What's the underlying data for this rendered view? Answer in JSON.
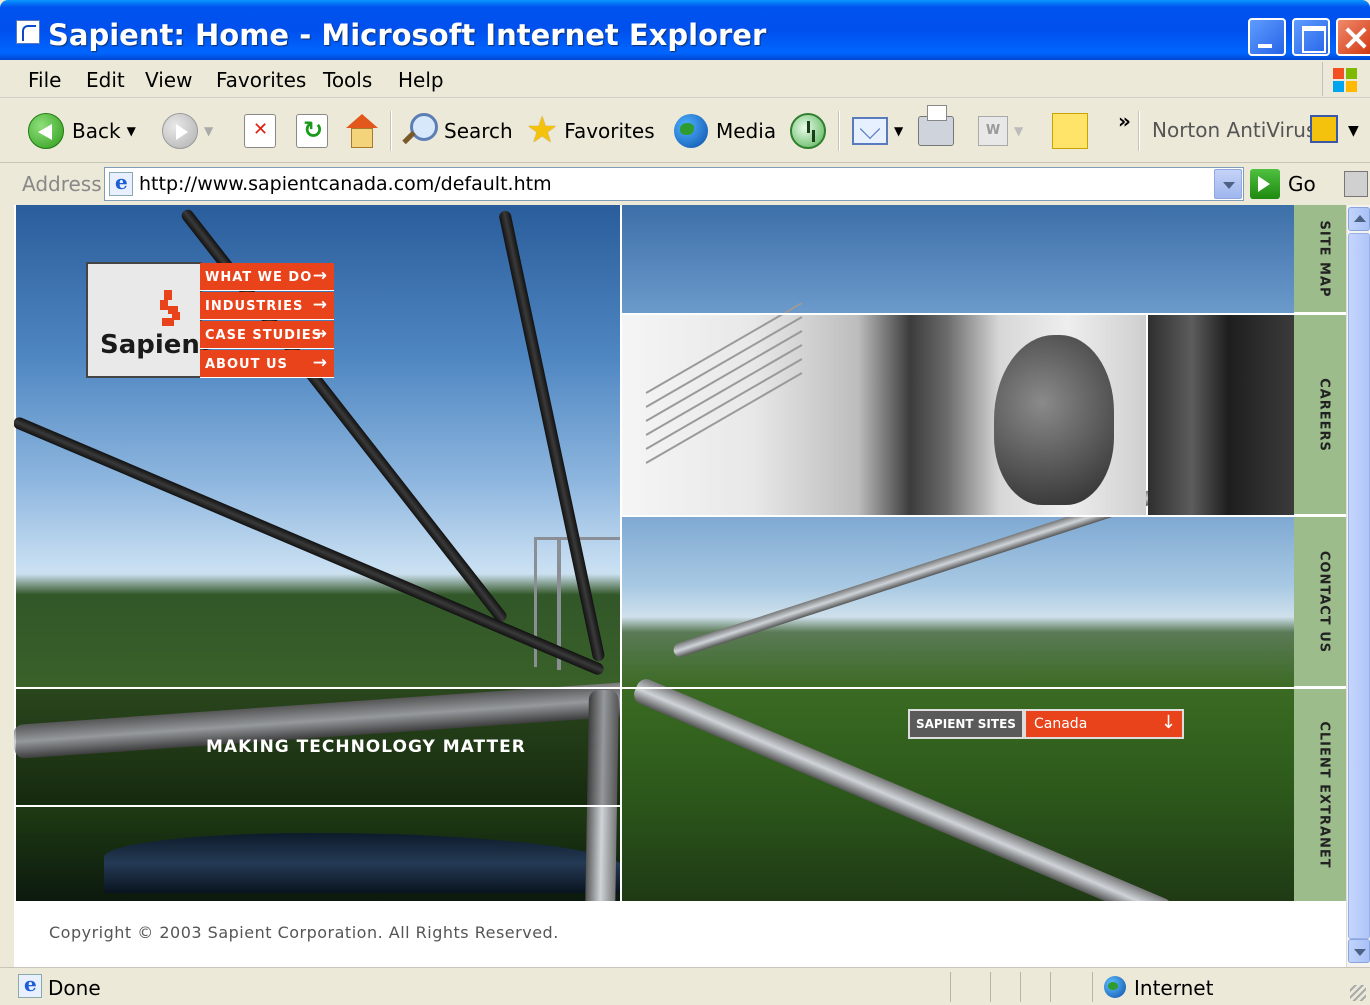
{
  "window": {
    "title": "Sapient: Home - Microsoft Internet Explorer"
  },
  "menubar": {
    "items": [
      "File",
      "Edit",
      "View",
      "Favorites",
      "Tools",
      "Help"
    ]
  },
  "toolbar": {
    "back_label": "Back",
    "search_label": "Search",
    "favorites_label": "Favorites",
    "media_label": "Media",
    "overflow_label": "»",
    "norton_label": "Norton AntiVirus",
    "icons": [
      "back-arrow-icon",
      "forward-arrow-icon",
      "stop-icon",
      "refresh-icon",
      "home-icon",
      "search-icon",
      "favorites-star-icon",
      "media-globe-icon",
      "history-icon",
      "mail-icon",
      "print-icon",
      "edit-icon",
      "discuss-icon",
      "norton-icon"
    ]
  },
  "addressbar": {
    "label": "Address",
    "url": "http://www.sapientcanada.com/default.htm",
    "go_label": "Go"
  },
  "page": {
    "logo_text": "Sapient",
    "nav": [
      {
        "label": "WHAT WE DO",
        "arrow": "→"
      },
      {
        "label": "INDUSTRIES",
        "arrow": "→"
      },
      {
        "label": "CASE STUDIES",
        "arrow": "→"
      },
      {
        "label": "ABOUT US",
        "arrow": "→"
      }
    ],
    "tagline": "MAKING TECHNOLOGY MATTER",
    "sites": {
      "label": "SAPIENT SITES",
      "selected": "Canada",
      "arrow": "↓"
    },
    "side_tabs": [
      "SITE MAP",
      "CAREERS",
      "CONTACT US",
      "CLIENT EXTRANET"
    ],
    "copyright": "Copyright © 2003 Sapient Corporation. All Rights Reserved.",
    "colors": {
      "accent": "#e8431b",
      "side_tab": "#9cbc8c"
    }
  },
  "statusbar": {
    "status": "Done",
    "zone": "Internet"
  }
}
